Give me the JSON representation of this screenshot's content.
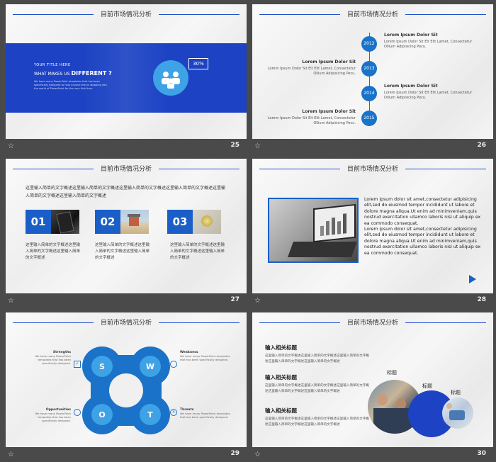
{
  "slide_title": "目前市场情况分析",
  "slides": [
    {
      "number": "25",
      "title": "目前市场情况分析",
      "banner_line1": "YOUR TITLE HERE",
      "banner_line2a": "WHAT MAKES US",
      "banner_line2b": "DIFFERENT ?",
      "banner_body": "We have many PowerPoint templates that has been specifically designed to help anyone that is stepping into the world of PowerPoint for the very first time.",
      "percent": "30%"
    },
    {
      "number": "26",
      "title": "目前市场情况分析",
      "years": [
        "2012",
        "2013",
        "2014",
        "2015"
      ],
      "items": [
        {
          "heading": "Lorem Ipsum Dolor Sit",
          "body": "Lorem Ipsum Dolor Sit Elt Elit Lamet, Consectetur Ollium Adipisicing Pecu."
        },
        {
          "heading": "Lorem Ipsum Dolor Sit",
          "body": "Lorem Ipsum Dolor Sit Elt Elit Lamet, Consectetur Ollium Adipisicing Pecu."
        },
        {
          "heading": "Lorem Ipsum Dolor Sit",
          "body": "Lorem Ipsum Dolor Sit Elt Elit Lamet, Consectetur Ollium Adipisicing Pecu."
        },
        {
          "heading": "Lorem Ipsum Dolor Sit",
          "body": "Lorem Ipsum Dolor Sit Elt Elit Lamet, Consectetur Ollium Adipisicing Pecu."
        }
      ]
    },
    {
      "number": "27",
      "title": "目前市场情况分析",
      "intro": "这里输入简单的文字概述这里输入简单的文字概述这里输入简单的文字概述这里输入简单的文字概述这里输入简单的文字概述这里输入简单的文字概述",
      "boxes": [
        {
          "num": "01",
          "text": "这里输入简单的文字概述这里输入简单的文字概述这里输入简单的文字概述"
        },
        {
          "num": "02",
          "text": "这里输入简单的文字概述这里输入简单的文字概述这里输入简单的文字概述"
        },
        {
          "num": "03",
          "text": "这里输入简单的文字概述这里输入简单的文字概述这里输入简单的文字概述"
        }
      ]
    },
    {
      "number": "28",
      "title": "目前市场情况分析",
      "para1": "Lorem ipsum dolor sit amet,consectetur adipisicing elit,sed do eiusmod tempor incididunt ut labore et dolore magna aliqua.Ut enim ad minimveniam,quis nostrud exercitation ullamco laboris nisi ut aliquip ex ea commodo consequat.",
      "para2": "Lorem ipsum dolor sit amet,consectetur adipisicing elit,sed do eiusmod tempor incididunt ut labore et dolore magna aliqua.Ut enim ad minimveniam,quis nostrud exercitation ullamco laboris nisi ut aliquip ex ea commodo consequat."
    },
    {
      "number": "29",
      "title": "目前市场情况分析",
      "letters": [
        "S",
        "W",
        "O",
        "T"
      ],
      "labels": [
        {
          "title": "Strengths",
          "body": "We have many PowerPoint templates that has been specifically designed."
        },
        {
          "title": "Weakness",
          "body": "We have many PowerPoint templates that has been specifically designed."
        },
        {
          "title": "Opportunities",
          "body": "We have many PowerPoint templates that has been specifically designed."
        },
        {
          "title": "Threats",
          "body": "We have many PowerPoint templates that has been specifically designed."
        }
      ]
    },
    {
      "number": "30",
      "title": "目前市场情况分析",
      "sections": [
        {
          "heading": "输入相关标题",
          "body": "这里输入简单的文字概述这里输入简单的文字概述这里输入简单的文字概述这里输入简单的文字概述这里输入简单的文字概述"
        },
        {
          "heading": "输入相关标题",
          "body": "这里输入简单的文字概述这里输入简单的文字概述这里输入简单的文字概述这里输入简单的文字概述这里输入简单的文字概述"
        },
        {
          "heading": "输入相关标题",
          "body": "这里输入简单的文字概述这里输入简单的文字概述这里输入简单的文字概述这里输入简单的文字概述这里输入简单的文字概述"
        }
      ],
      "circle_labels": [
        "标题",
        "标题",
        "标题"
      ]
    }
  ],
  "colors": {
    "accent": "#1f4fcc",
    "brand_blue": "#1a73c8",
    "light_blue": "#3ea2e6"
  }
}
